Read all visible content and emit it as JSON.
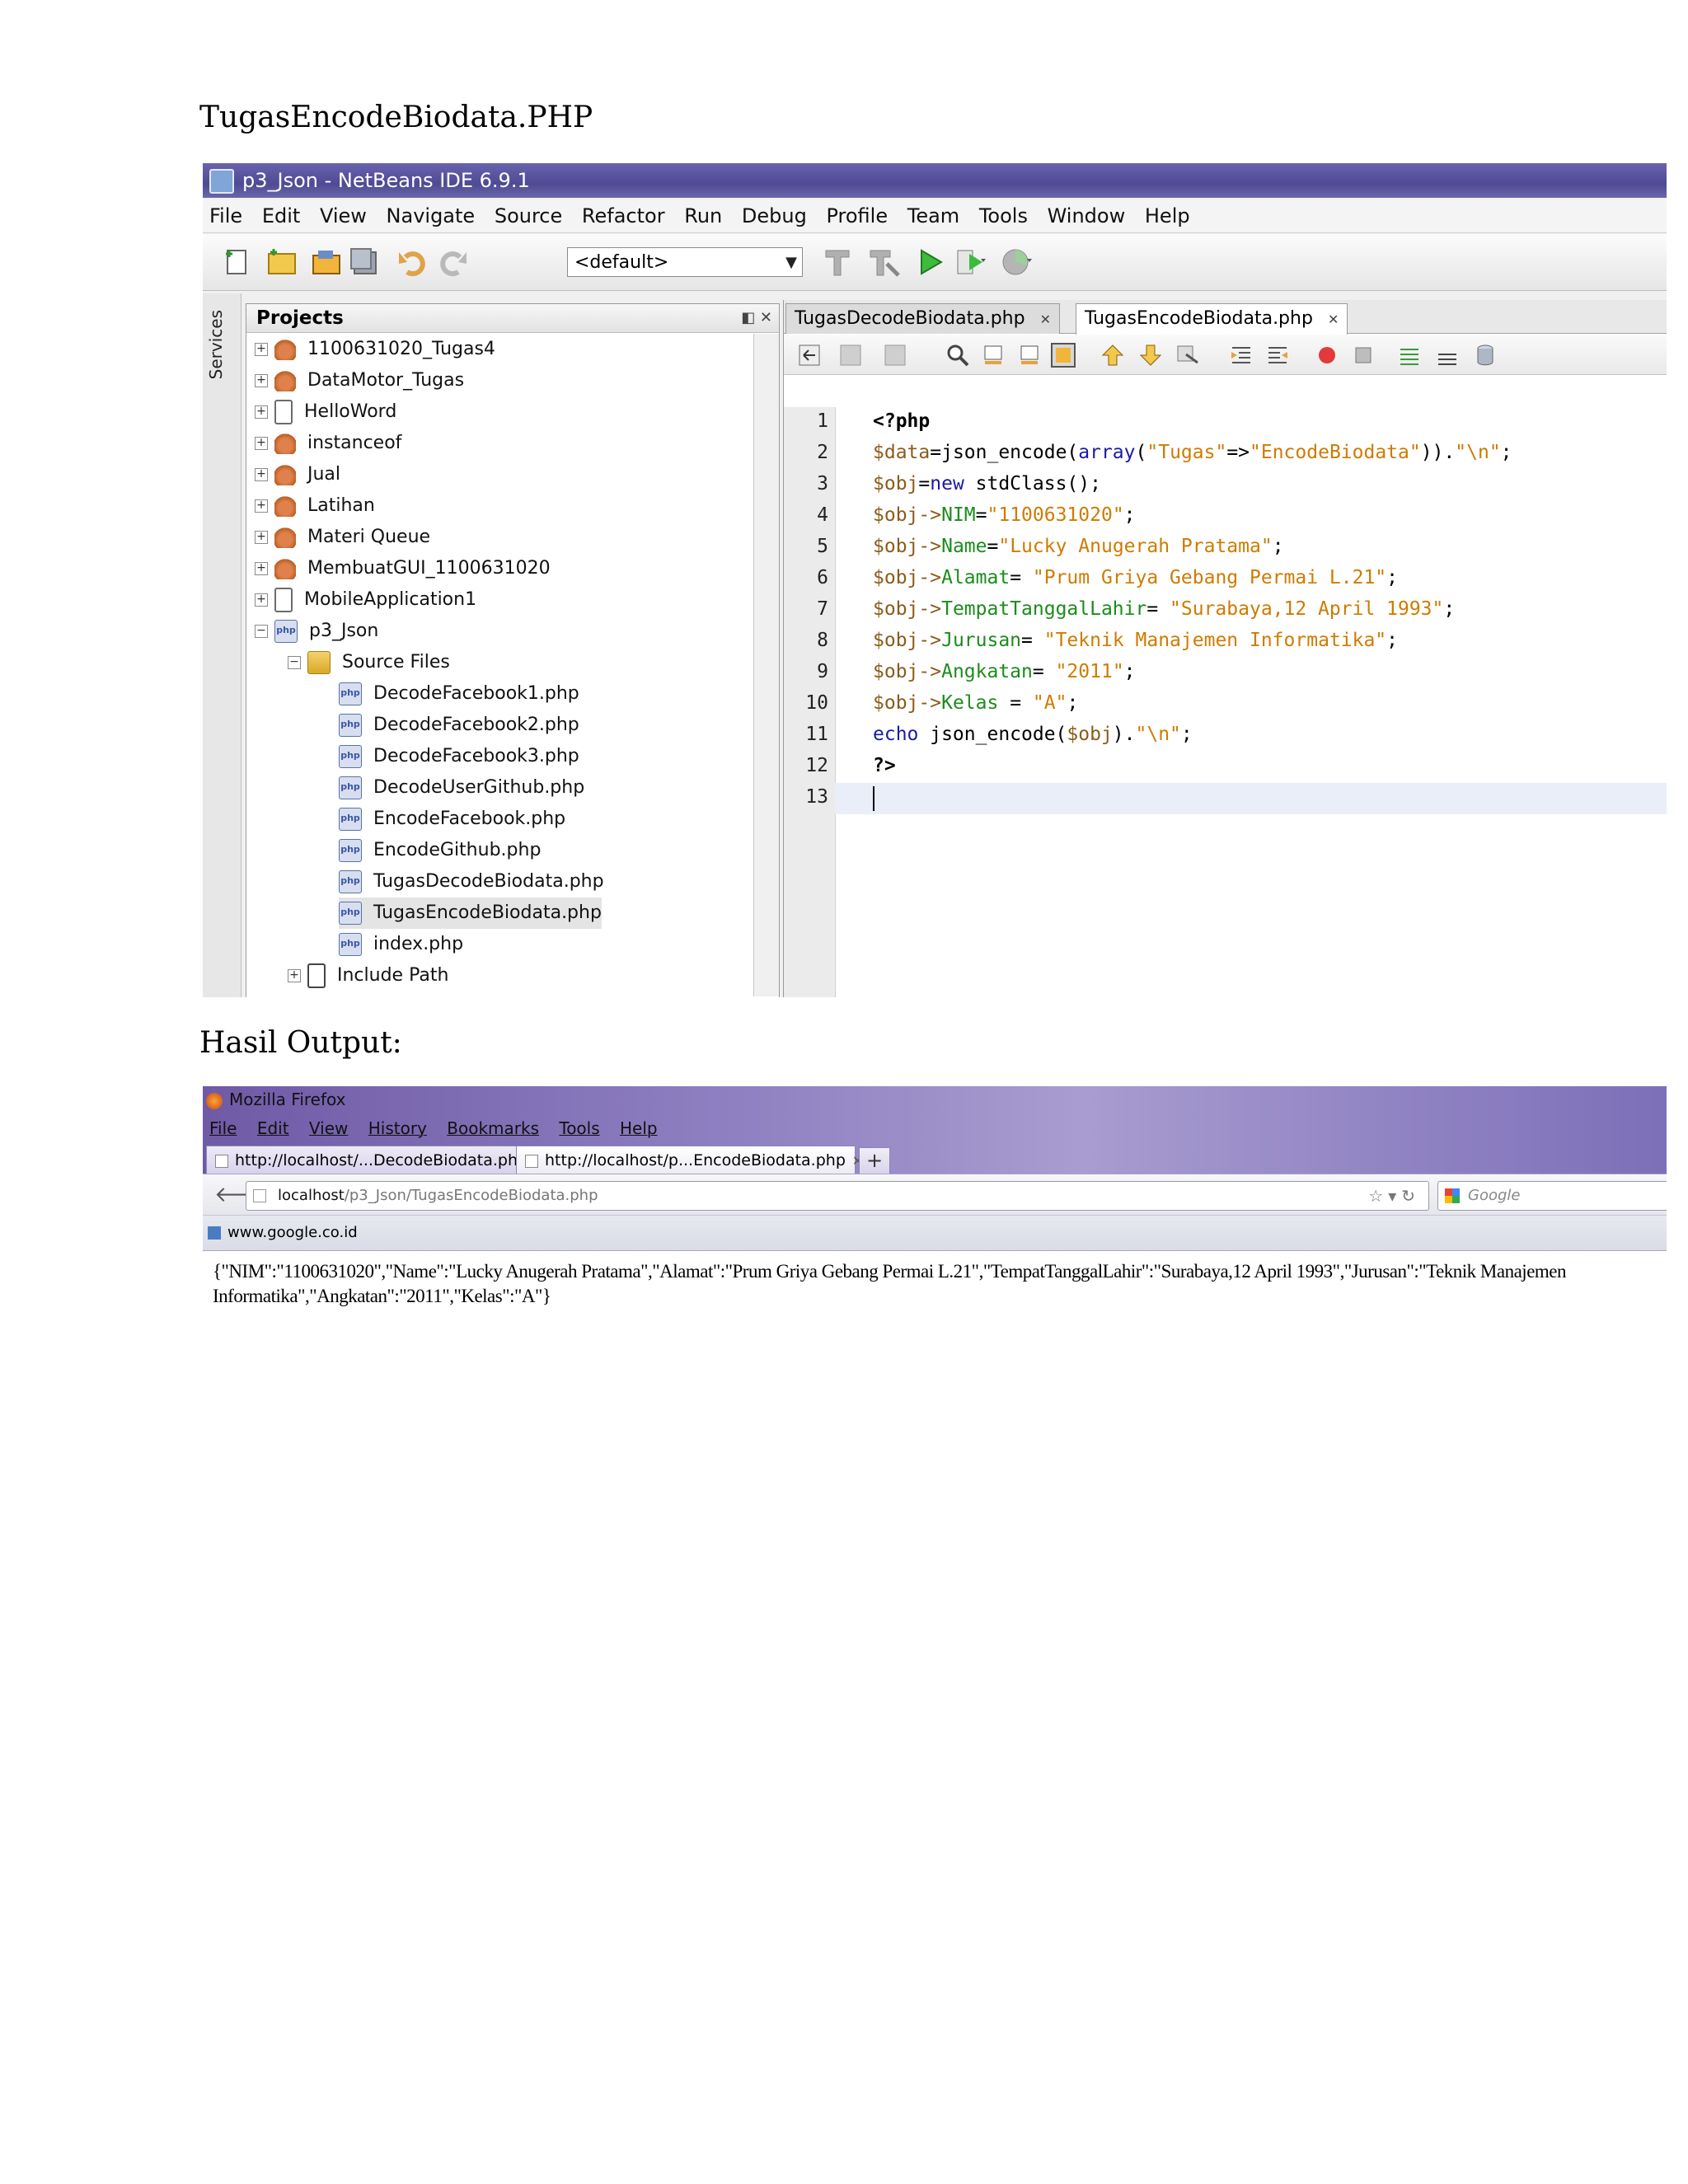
{
  "document": {
    "heading1": "TugasEncodeBiodata.PHP",
    "heading2": "Hasil Output:"
  },
  "ide": {
    "title": "p3_Json - NetBeans IDE 6.9.1",
    "menu": [
      "File",
      "Edit",
      "View",
      "Navigate",
      "Source",
      "Refactor",
      "Run",
      "Debug",
      "Profile",
      "Team",
      "Tools",
      "Window",
      "Help"
    ],
    "config_select": "<default>",
    "services_label": "Services",
    "projects_title": "Projects",
    "tree": [
      {
        "label": "1100631020_Tugas4",
        "icon": "java-project-icon"
      },
      {
        "label": "DataMotor_Tugas",
        "icon": "java-project-icon"
      },
      {
        "label": "HelloWord",
        "icon": "mobile-project-icon"
      },
      {
        "label": "instanceof",
        "icon": "java-project-icon"
      },
      {
        "label": "Jual",
        "icon": "java-project-icon"
      },
      {
        "label": "Latihan",
        "icon": "java-project-icon"
      },
      {
        "label": "Materi Queue",
        "icon": "java-project-icon"
      },
      {
        "label": "MembuatGUI_1100631020",
        "icon": "java-project-icon"
      },
      {
        "label": "MobileApplication1",
        "icon": "mobile-project-icon"
      },
      {
        "label": "p3_Json",
        "icon": "php-project-icon"
      },
      {
        "label": "Source Files",
        "icon": "folder-icon"
      },
      {
        "label": "DecodeFacebook1.php",
        "icon": "php-file-icon"
      },
      {
        "label": "DecodeFacebook2.php",
        "icon": "php-file-icon"
      },
      {
        "label": "DecodeFacebook3.php",
        "icon": "php-file-icon"
      },
      {
        "label": "DecodeUserGithub.php",
        "icon": "php-file-icon"
      },
      {
        "label": "EncodeFacebook.php",
        "icon": "php-file-icon"
      },
      {
        "label": "EncodeGithub.php",
        "icon": "php-file-icon"
      },
      {
        "label": "TugasDecodeBiodata.php",
        "icon": "php-file-icon"
      },
      {
        "label": "TugasEncodeBiodata.php",
        "icon": "php-file-icon",
        "selected": true
      },
      {
        "label": "index.php",
        "icon": "php-file-icon"
      },
      {
        "label": "Include Path",
        "icon": "library-icon"
      }
    ],
    "editor_tabs": [
      {
        "label": "TugasDecodeBiodata.php",
        "active": false
      },
      {
        "label": "TugasEncodeBiodata.php",
        "active": true
      }
    ],
    "line_numbers": [
      "1",
      "2",
      "3",
      "4",
      "5",
      "6",
      "7",
      "8",
      "9",
      "10",
      "11",
      "12",
      "13"
    ],
    "code_lines": [
      "<?php",
      "$data=json_encode(array(\"Tugas\"=>\"EncodeBiodata\")).\"\\n\";",
      "$obj=new stdClass();",
      "$obj->NIM=\"1100631020\";",
      "$obj->Name=\"Lucky Anugerah Pratama\";",
      "$obj->Alamat= \"Prum Griya Gebang Permai L.21\";",
      "$obj->TempatTanggalLahir= \"Surabaya,12 April 1993\";",
      "$obj->Jurusan= \"Teknik Manajemen Informatika\";",
      "$obj->Angkatan= \"2011\";",
      "$obj->Kelas = \"A\";",
      "echo json_encode($obj).\"\\n\";",
      "?>",
      ""
    ]
  },
  "browser": {
    "title": "Mozilla Firefox",
    "menu": [
      "File",
      "Edit",
      "View",
      "History",
      "Bookmarks",
      "Tools",
      "Help"
    ],
    "tabs": [
      {
        "label": "http://localhost/...DecodeBiodata.php",
        "active": false
      },
      {
        "label": "http://localhost/p...EncodeBiodata.php",
        "active": true
      }
    ],
    "new_tab": "+",
    "url_host": "localhost",
    "url_path": "/p3_Json/TugasEncodeBiodata.php",
    "search_placeholder": "Google",
    "bookmark": "www.google.co.id",
    "output_line1": "{\"NIM\":\"1100631020\",\"Name\":\"Lucky Anugerah Pratama\",\"Alamat\":\"Prum Griya Gebang Permai L.21\",\"TempatTanggalLahir\":\"Surabaya,12 April 1993\",\"Jurusan\":\"Teknik Manajemen",
    "output_line2": "Informatika\",\"Angkatan\":\"2011\",\"Kelas\":\"A\"}"
  }
}
